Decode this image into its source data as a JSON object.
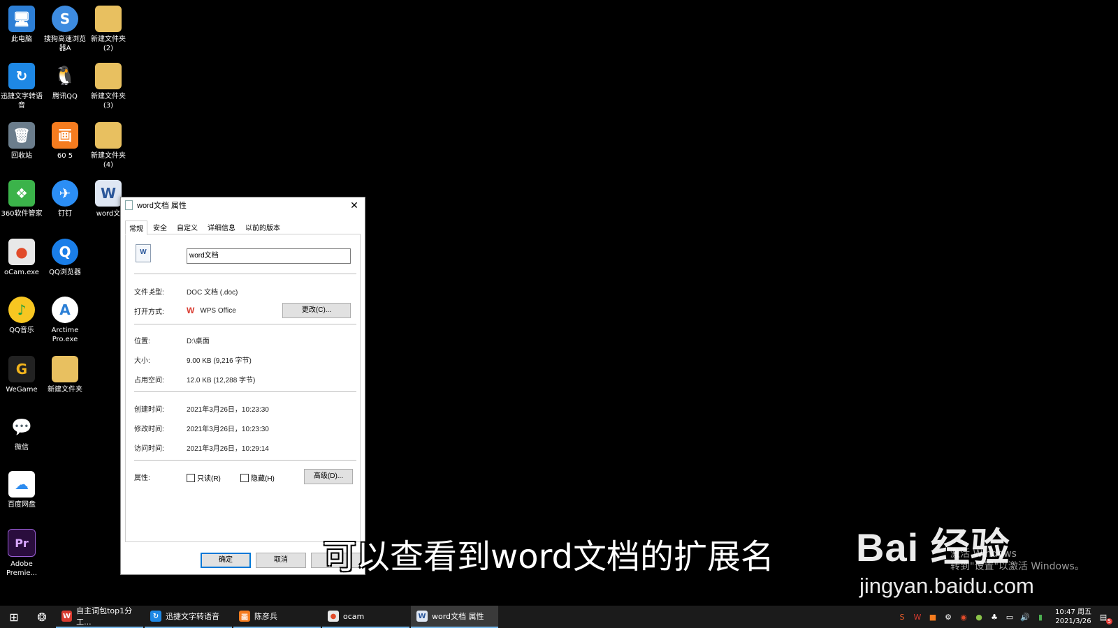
{
  "desktop_icons": [
    {
      "label": "此电脑",
      "glyph": "🖥",
      "color": "#2d7fd6",
      "icon": "computer-icon"
    },
    {
      "label": "搜狗高速浏览器A",
      "glyph": "S",
      "color": "#3d8be0",
      "icon": "sogou-browser-icon"
    },
    {
      "label": "新建文件夹 (2)",
      "glyph": "",
      "color": "#e8c060",
      "icon": "folder-icon"
    },
    {
      "label": "迅捷文字转语音",
      "glyph": "↻",
      "color": "#1e88e5",
      "icon": "tts-app-icon"
    },
    {
      "label": "腾讯QQ",
      "glyph": "🐧",
      "color": "#000000",
      "icon": "qq-icon"
    },
    {
      "label": "新建文件夹 (3)",
      "glyph": "",
      "color": "#e8c060",
      "icon": "folder-icon"
    },
    {
      "label": "回收站",
      "glyph": "🗑",
      "color": "#6b7d8c",
      "icon": "recycle-bin-icon"
    },
    {
      "label": "60 5",
      "glyph": "画",
      "color": "#f57c1f",
      "icon": "app-60-icon"
    },
    {
      "label": "新建文件夹 (4)",
      "glyph": "",
      "color": "#e8c060",
      "icon": "folder-icon"
    },
    {
      "label": "360软件管家",
      "glyph": "❖",
      "color": "#3bb34a",
      "icon": "360-manager-icon"
    },
    {
      "label": "钉钉",
      "glyph": "✈",
      "color": "#2b8ef5",
      "icon": "dingtalk-icon"
    },
    {
      "label": "word文",
      "glyph": "W",
      "color": "#dfe7f3",
      "icon": "word-doc-icon"
    },
    {
      "label": "oCam.exe",
      "glyph": "●",
      "color": "#e8e8e8",
      "icon": "ocam-icon"
    },
    {
      "label": "QQ浏览器",
      "glyph": "Q",
      "color": "#1a7ee8",
      "icon": "qq-browser-icon"
    },
    {
      "label": "QQ音乐",
      "glyph": "♪",
      "color": "#f7c621",
      "icon": "qq-music-icon"
    },
    {
      "label": "Arctime Pro.exe",
      "glyph": "A",
      "color": "#ffffff",
      "icon": "arctime-icon"
    },
    {
      "label": "WeGame",
      "glyph": "G",
      "color": "#222222",
      "icon": "wegame-icon"
    },
    {
      "label": "新建文件夹",
      "glyph": "",
      "color": "#e8c060",
      "icon": "folder-icon"
    },
    {
      "label": "微信",
      "glyph": "💬",
      "color": "#000000",
      "icon": "wechat-icon"
    },
    {
      "label": "百度网盘",
      "glyph": "☁",
      "color": "#ffffff",
      "icon": "baidu-netdisk-icon"
    },
    {
      "label": "Adobe Premie...",
      "glyph": "Pr",
      "color": "#2a0d3d",
      "icon": "premiere-icon"
    }
  ],
  "dialog": {
    "title": "word文档 属性",
    "tabs": [
      "常规",
      "安全",
      "自定义",
      "详细信息",
      "以前的版本"
    ],
    "file_name": "word文档",
    "rows": {
      "type_label": "文件类型:",
      "type_value": "DOC 文档 (.doc)",
      "open_label": "打开方式:",
      "open_value": "WPS Office",
      "change_button": "更改(C)...",
      "location_label": "位置:",
      "location_value": "D:\\桌面",
      "size_label": "大小:",
      "size_value": "9.00 KB (9,216 字节)",
      "disk_label": "占用空间:",
      "disk_value": "12.0 KB (12,288 字节)",
      "created_label": "创建时间:",
      "created_value": "2021年3月26日，10:23:30",
      "modified_label": "修改时间:",
      "modified_value": "2021年3月26日，10:23:30",
      "accessed_label": "访问时间:",
      "accessed_value": "2021年3月26日，10:29:14",
      "attr_label": "属性:",
      "readonly_label": "只读(R)",
      "hidden_label": "隐藏(H)",
      "advanced_button": "高级(D)..."
    },
    "ok_button": "确定",
    "cancel_button": "取消"
  },
  "caption": "可以查看到word文档的扩展名",
  "watermark": {
    "logo": "Bai 经验",
    "url": "jingyan.baidu.com"
  },
  "activate_windows": {
    "line1": "激活 Windows",
    "line2": "转到\"设置\"以激活 Windows。"
  },
  "taskbar": {
    "items": [
      {
        "label": "自主词包top1分工...",
        "icon": "wps-icon",
        "color": "#d93b30",
        "glyph": "W"
      },
      {
        "label": "迅捷文字转语音",
        "icon": "tts-app-icon",
        "color": "#1e88e5",
        "glyph": "↻"
      },
      {
        "label": "陈彦兵",
        "icon": "app-60-icon",
        "color": "#f57c1f",
        "glyph": "画"
      },
      {
        "label": "ocam",
        "icon": "ocam-icon",
        "color": "#e8e8e8",
        "glyph": "●"
      },
      {
        "label": "word文档 属性",
        "icon": "word-doc-icon",
        "color": "#dfe7f3",
        "glyph": "W"
      }
    ],
    "clock_time": "10:47 周五",
    "clock_date": "2021/3/26",
    "notification_count": "5"
  }
}
